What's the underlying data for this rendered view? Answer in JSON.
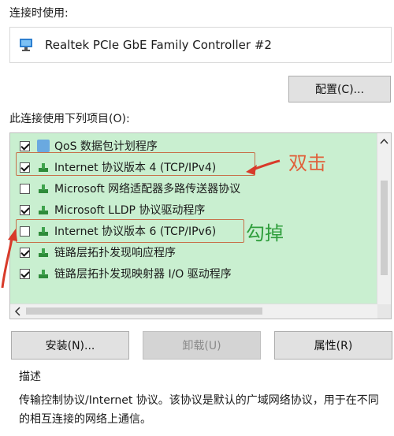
{
  "section": {
    "connect_using_label": "连接时使用:",
    "items_label": "此连接使用下列项目(O):",
    "description_label": "描述",
    "description_text": "传输控制协议/Internet 协议。该协议是默认的广域网络协议，用于在不同的相互连接的网络上通信。"
  },
  "adapter": {
    "name": "Realtek PCIe GbE Family Controller #2",
    "icon": "network-adapter-icon"
  },
  "buttons": {
    "configure": "配置(C)...",
    "install": "安装(N)...",
    "uninstall": "卸载(U)",
    "properties": "属性(R)"
  },
  "items": [
    {
      "label": "QoS 数据包计划程序",
      "checked": true,
      "icon": "qos-icon"
    },
    {
      "label": "Internet 协议版本 4 (TCP/IPv4)",
      "checked": true,
      "icon": "protocol-icon"
    },
    {
      "label": "Microsoft 网络适配器多路传送器协议",
      "checked": false,
      "icon": "protocol-icon"
    },
    {
      "label": "Microsoft LLDP 协议驱动程序",
      "checked": true,
      "icon": "protocol-icon"
    },
    {
      "label": "Internet 协议版本 6 (TCP/IPv6)",
      "checked": false,
      "icon": "protocol-icon"
    },
    {
      "label": "链路层拓扑发现响应程序",
      "checked": true,
      "icon": "protocol-icon"
    },
    {
      "label": "链路层拓扑发现映射器 I/O 驱动程序",
      "checked": true,
      "icon": "protocol-icon"
    }
  ],
  "annotations": {
    "double_click": "双击",
    "uncheck": "勾掉"
  },
  "colors": {
    "list_highlight": "#c9efd0",
    "annotation_red": "#e0603a",
    "annotation_green": "#2f9e3c"
  }
}
